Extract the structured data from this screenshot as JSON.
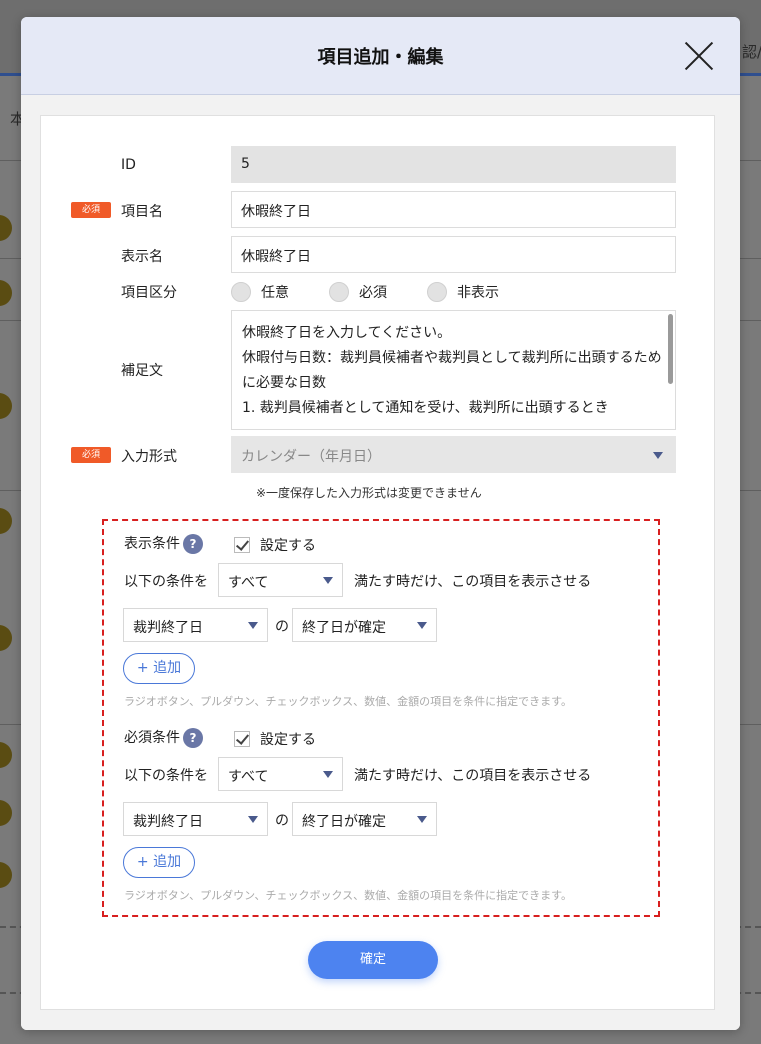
{
  "background": {
    "header_fragment": "認/",
    "side_fragment": "本"
  },
  "modal": {
    "title": "項目追加・編集"
  },
  "form": {
    "required_badge": "必須",
    "id": {
      "label": "ID",
      "value": "5"
    },
    "item_name": {
      "label": "項目名",
      "value": "休暇終了日"
    },
    "display_name": {
      "label": "表示名",
      "value": "休暇終了日"
    },
    "item_category": {
      "label": "項目区分",
      "options": [
        "任意",
        "必須",
        "非表示"
      ]
    },
    "supplement": {
      "label": "補足文",
      "lines": [
        "休暇終了日を入力してください。",
        "休暇付与日数：裁判員候補者や裁判員として裁判所に出頭するため",
        "に必要な日数",
        "1. 裁判員候補者として通知を受け、裁判所に出頭するとき"
      ]
    },
    "input_type": {
      "label": "入力形式",
      "value": "カレンダー（年月日）"
    },
    "input_type_note": "※一度保存した入力形式は変更できません"
  },
  "conditions": {
    "display": {
      "label": "表示条件",
      "help": "?",
      "checkbox_label": "設定する",
      "prefix": "以下の条件を",
      "match_value": "すべて",
      "suffix": "満たす時だけ、この項目を表示させる",
      "field_value": "裁判終了日",
      "connector": "の",
      "state_value": "終了日が確定",
      "add_label": "+ 追加",
      "hint": "ラジオボタン、プルダウン、チェックボックス、数値、金額の項目を条件に指定できます。"
    },
    "required": {
      "label": "必須条件",
      "help": "?",
      "checkbox_label": "設定する",
      "prefix": "以下の条件を",
      "match_value": "すべて",
      "suffix": "満たす時だけ、この項目を表示させる",
      "field_value": "裁判終了日",
      "connector": "の",
      "state_value": "終了日が確定",
      "add_label": "+ 追加",
      "hint": "ラジオボタン、プルダウン、チェックボックス、数値、金額の項目を条件に指定できます。"
    }
  },
  "confirm_label": "確定",
  "colors": {
    "header_bg": "#e5e9f6",
    "required_badge": "#f05a28",
    "dashed_border": "#d81f1f",
    "primary": "#4d83f0",
    "help_icon": "#6a77a6"
  }
}
